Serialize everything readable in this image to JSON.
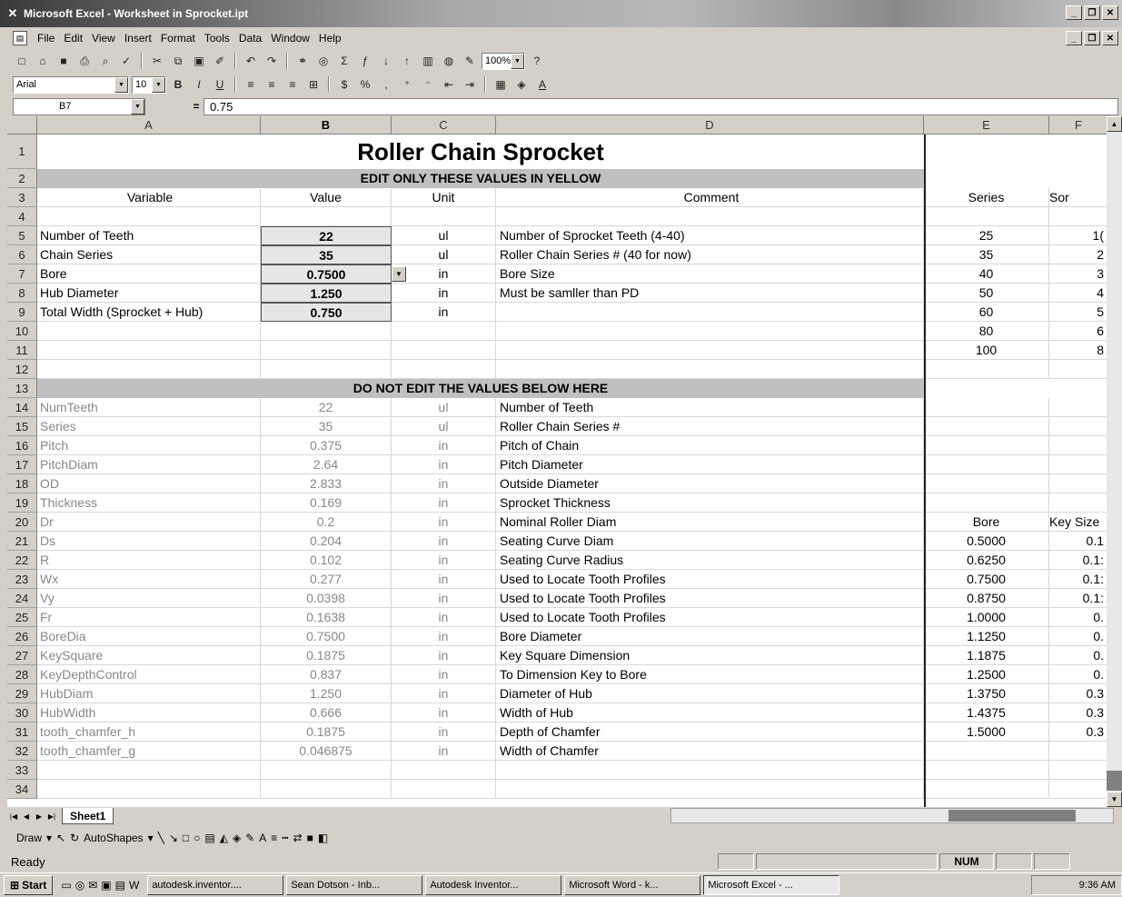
{
  "window": {
    "title": "Microsoft Excel - Worksheet in Sprocket.ipt",
    "app_icon": "excel-icon"
  },
  "menu": [
    "File",
    "Edit",
    "View",
    "Insert",
    "Format",
    "Tools",
    "Data",
    "Window",
    "Help"
  ],
  "toolbar": {
    "zoom": "100%",
    "font_name": "Arial",
    "font_size": "10"
  },
  "formula": {
    "cell_ref": "B7",
    "value": "0.75"
  },
  "columns": [
    "A",
    "B",
    "C",
    "D",
    "E",
    "F"
  ],
  "title": "Roller Chain Sprocket",
  "edit_banner": "EDIT ONLY THESE VALUES IN YELLOW",
  "noedit_banner": "DO NOT EDIT THE VALUES BELOW HERE",
  "headers": {
    "variable": "Variable",
    "value": "Value",
    "unit": "Unit",
    "comment": "Comment",
    "series": "Series",
    "sort": "Sor"
  },
  "inputs": [
    {
      "row": "5",
      "name": "Number of Teeth",
      "value": "22",
      "unit": "ul",
      "comment": "Number of Sprocket Teeth (4-40)",
      "e": "25",
      "f": "1("
    },
    {
      "row": "6",
      "name": "Chain Series",
      "value": "35",
      "unit": "ul",
      "comment": "Roller Chain Series # (40 for now)",
      "e": "35",
      "f": "2"
    },
    {
      "row": "7",
      "name": "Bore",
      "value": "0.7500",
      "unit": "in",
      "comment": "Bore Size",
      "e": "40",
      "f": "3"
    },
    {
      "row": "8",
      "name": "Hub Diameter",
      "value": "1.250",
      "unit": "in",
      "comment": "Must be samller than PD",
      "e": "50",
      "f": "4"
    },
    {
      "row": "9",
      "name": "Total Width (Sprocket + Hub)",
      "value": "0.750",
      "unit": "in",
      "comment": "",
      "e": "60",
      "f": "5"
    }
  ],
  "extra_series": [
    {
      "row": "10",
      "e": "80",
      "f": "6"
    },
    {
      "row": "11",
      "e": "100",
      "f": "8"
    }
  ],
  "computed": [
    {
      "row": "14",
      "name": "NumTeeth",
      "value": "22",
      "unit": "ul",
      "comment": "Number of Teeth",
      "e": "",
      "f": ""
    },
    {
      "row": "15",
      "name": "Series",
      "value": "35",
      "unit": "ul",
      "comment": "Roller Chain Series #",
      "e": "",
      "f": ""
    },
    {
      "row": "16",
      "name": "Pitch",
      "value": "0.375",
      "unit": "in",
      "comment": "Pitch of Chain",
      "e": "",
      "f": ""
    },
    {
      "row": "17",
      "name": "PitchDiam",
      "value": "2.64",
      "unit": "in",
      "comment": "Pitch Diameter",
      "e": "",
      "f": ""
    },
    {
      "row": "18",
      "name": "OD",
      "value": "2.833",
      "unit": "in",
      "comment": "Outside Diameter",
      "e": "",
      "f": ""
    },
    {
      "row": "19",
      "name": "Thickness",
      "value": "0.169",
      "unit": "in",
      "comment": "Sprocket Thickness",
      "e": "",
      "f": ""
    },
    {
      "row": "20",
      "name": "Dr",
      "value": "0.2",
      "unit": "in",
      "comment": "Nominal Roller Diam",
      "e": "Bore",
      "f": "Key Size"
    },
    {
      "row": "21",
      "name": "Ds",
      "value": "0.204",
      "unit": "in",
      "comment": "Seating Curve Diam",
      "e": "0.5000",
      "f": "0.1"
    },
    {
      "row": "22",
      "name": "R",
      "value": "0.102",
      "unit": "in",
      "comment": "Seating Curve Radius",
      "e": "0.6250",
      "f": "0.1:"
    },
    {
      "row": "23",
      "name": "Wx",
      "value": "0.277",
      "unit": "in",
      "comment": "Used to Locate Tooth Profiles",
      "e": "0.7500",
      "f": "0.1:"
    },
    {
      "row": "24",
      "name": "Vy",
      "value": "0.0398",
      "unit": "in",
      "comment": "Used to Locate Tooth Profiles",
      "e": "0.8750",
      "f": "0.1:"
    },
    {
      "row": "25",
      "name": "Fr",
      "value": "0.1638",
      "unit": "in",
      "comment": "Used to Locate Tooth Profiles",
      "e": "1.0000",
      "f": "0."
    },
    {
      "row": "26",
      "name": "BoreDia",
      "value": "0.7500",
      "unit": "in",
      "comment": "Bore Diameter",
      "e": "1.1250",
      "f": "0."
    },
    {
      "row": "27",
      "name": "KeySquare",
      "value": "0.1875",
      "unit": "in",
      "comment": "Key Square Dimension",
      "e": "1.1875",
      "f": "0."
    },
    {
      "row": "28",
      "name": "KeyDepthControl",
      "value": "0.837",
      "unit": "in",
      "comment": "To Dimension Key to Bore",
      "e": "1.2500",
      "f": "0."
    },
    {
      "row": "29",
      "name": "HubDiam",
      "value": "1.250",
      "unit": "in",
      "comment": "Diameter of Hub",
      "e": "1.3750",
      "f": "0.3"
    },
    {
      "row": "30",
      "name": "HubWidth",
      "value": "0.666",
      "unit": "in",
      "comment": "Width of Hub",
      "e": "1.4375",
      "f": "0.3"
    },
    {
      "row": "31",
      "name": "tooth_chamfer_h",
      "value": "0.1875",
      "unit": "in",
      "comment": "Depth of Chamfer",
      "e": "1.5000",
      "f": "0.3"
    },
    {
      "row": "32",
      "name": "tooth_chamfer_g",
      "value": "0.046875",
      "unit": "in",
      "comment": "Width of Chamfer",
      "e": "",
      "f": ""
    }
  ],
  "empty_rows": [
    "4",
    "10",
    "11",
    "12",
    "33",
    "34"
  ],
  "sheet_tab": "Sheet1",
  "drawbar": {
    "draw": "Draw",
    "autoshapes": "AutoShapes"
  },
  "status": {
    "ready": "Ready",
    "num": "NUM"
  },
  "taskbar": {
    "start": "Start",
    "tasks": [
      "autodesk.inventor....",
      "Sean Dotson - Inb...",
      "Autodesk Inventor...",
      "Microsoft Word - k...",
      "Microsoft Excel - ..."
    ],
    "time": "9:36 AM"
  }
}
